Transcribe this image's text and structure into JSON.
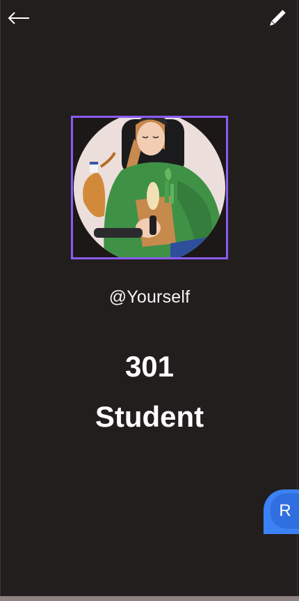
{
  "header": {
    "back_icon": "arrow-left-icon",
    "edit_icon": "pencil-icon"
  },
  "profile": {
    "avatar_description": "3D illustration of person with grocery bag",
    "handle": "@Yourself",
    "count": "301",
    "role": "Student"
  },
  "fab": {
    "letter": "R"
  },
  "colors": {
    "background": "#221e1d",
    "avatar_border": "#8b5cf6",
    "fab": "#3b82f6"
  }
}
